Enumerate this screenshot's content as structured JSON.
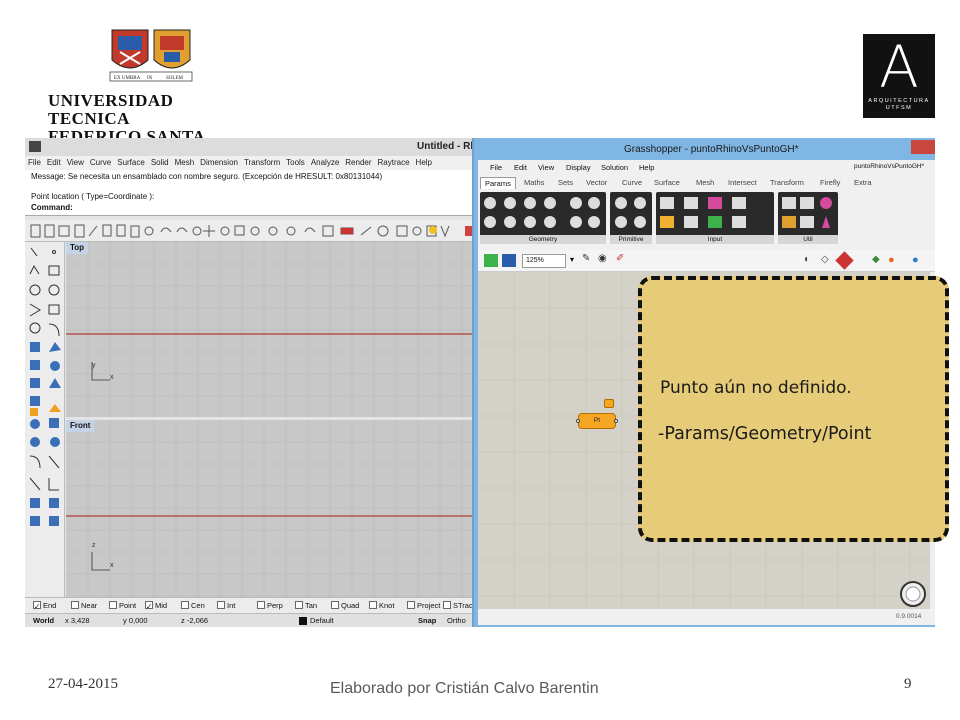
{
  "header": {
    "university_name_line1": "UNIVERSIDAD TECNICA",
    "university_name_line2": "FEDERICO SANTA MARIA",
    "arq_logo_letter": "A",
    "arq_logo_text_line1": "ARQUITECTURA",
    "arq_logo_text_line2": "UTFSM",
    "crest_motto_left": "EX UMBRA",
    "crest_motto_mid": "IN",
    "crest_motto_right": "SOLEM"
  },
  "rhino": {
    "title": "Untitled - Rhino",
    "menu": [
      "File",
      "Edit",
      "View",
      "Curve",
      "Surface",
      "Solid",
      "Mesh",
      "Dimension",
      "Transform",
      "Tools",
      "Analyze",
      "Render",
      "Raytrace",
      "Help"
    ],
    "command_history": [
      "Message: Se necesita un ensamblado con nombre seguro. (Excepción de HRESULT: 0x80131044)",
      "",
      "Point location ( Type=Coordinate ):"
    ],
    "command_prompt": "Command:",
    "viewports": {
      "top_label": "Top",
      "front_label": "Front",
      "top_axis_y": "y",
      "top_axis_x": "x",
      "front_axis_z": "z",
      "front_axis_x": "x"
    },
    "osnaps": [
      {
        "label": "End",
        "checked": true
      },
      {
        "label": "Near",
        "checked": false
      },
      {
        "label": "Point",
        "checked": false
      },
      {
        "label": "Mid",
        "checked": true
      },
      {
        "label": "Cen",
        "checked": false
      },
      {
        "label": "Int",
        "checked": false
      },
      {
        "label": "Perp",
        "checked": false
      },
      {
        "label": "Tan",
        "checked": false
      },
      {
        "label": "Quad",
        "checked": false
      },
      {
        "label": "Knot",
        "checked": false
      },
      {
        "label": "Project",
        "checked": false
      },
      {
        "label": "STrac",
        "checked": false
      }
    ],
    "status": {
      "cplane": "World",
      "x": "x 3,428",
      "y": "y 0,000",
      "z": "z -2,066",
      "layer": "Default",
      "snap": "Snap",
      "ortho": "Ortho"
    },
    "accent_red": "#b23a3a"
  },
  "grasshopper": {
    "title": "Grasshopper - puntoRhinoVsPuntoGH*",
    "document_name": "puntoRhinoVsPuntoGH*",
    "menu": [
      "File",
      "Edit",
      "View",
      "Display",
      "Solution",
      "Help"
    ],
    "tabs": [
      "Params",
      "Maths",
      "Sets",
      "Vector",
      "Curve",
      "Surface",
      "Mesh",
      "Intersect",
      "Transform",
      "Firefly",
      "Extra"
    ],
    "active_tab": "Params",
    "ribbon_groups": [
      "Geometry",
      "Primitive",
      "Input",
      "Util"
    ],
    "zoom": "125%",
    "component_label": "Pt",
    "version": "0.9.0014",
    "component_color": "#f5a623"
  },
  "callout": {
    "line1": "Punto aún no definido.",
    "line2": "-Params/Geometry/Point",
    "background": "#e6cc78"
  },
  "footer": {
    "date": "27-04-2015",
    "author": "Elaborado por Cristián Calvo Barentin",
    "page_number": "9"
  }
}
